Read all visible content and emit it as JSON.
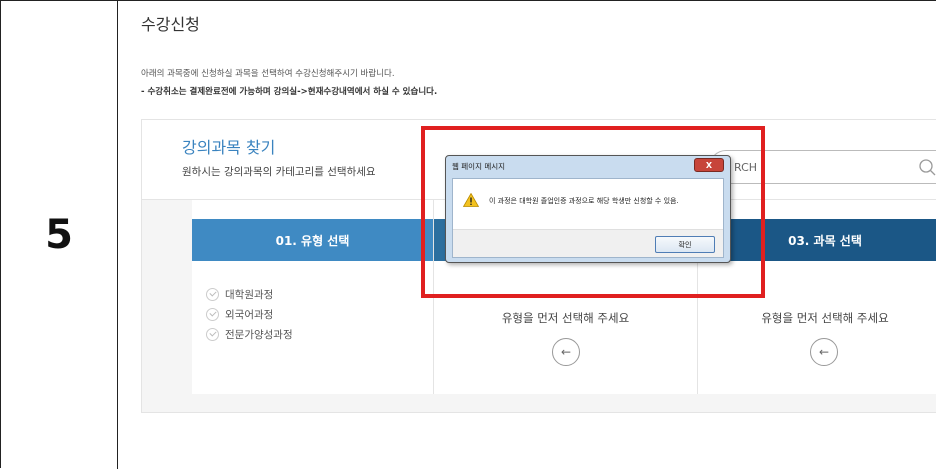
{
  "step": {
    "number": "5"
  },
  "page": {
    "title": "수강신청",
    "notice_lines": [
      "아래의 과목중에 신청하실 과목을 선택하여 수강신청해주시기 바랍니다.",
      "- 수강취소는 결제완료전에 가능하며 강의실->현재수강내역에서 하실 수 있습니다."
    ]
  },
  "finder": {
    "title": "강의과목 찾기",
    "subtitle": "원하시는 강의과목의 카테고리를 선택하세요",
    "search_text": "RCH"
  },
  "columns": [
    {
      "header": "01. 유형 선택"
    },
    {
      "header": "",
      "hint": "유형을 먼저 선택해 주세요"
    },
    {
      "header": "03. 과목 선택",
      "hint": "유형을 먼저 선택해 주세요"
    }
  ],
  "types": [
    "대학원과정",
    "외국어과정",
    "전문가양성과정"
  ],
  "dialog": {
    "title": "웹 페이지 메시지",
    "close_label": "X",
    "message": "이 과정은 대학원 졸업인증 과정으로 해당 학생만 신청할 수 있음.",
    "ok_label": "확인"
  },
  "icons": {
    "search": "search-icon",
    "arrow": "arrow-left-icon",
    "warning": "warning-icon",
    "check": "check-circle-icon"
  },
  "colors": {
    "accent": "#3a83bf",
    "col1_header": "#3f8ac3",
    "col2_header": "#2c6f9f",
    "col3_header": "#1b5786",
    "highlight": "#e02020"
  }
}
